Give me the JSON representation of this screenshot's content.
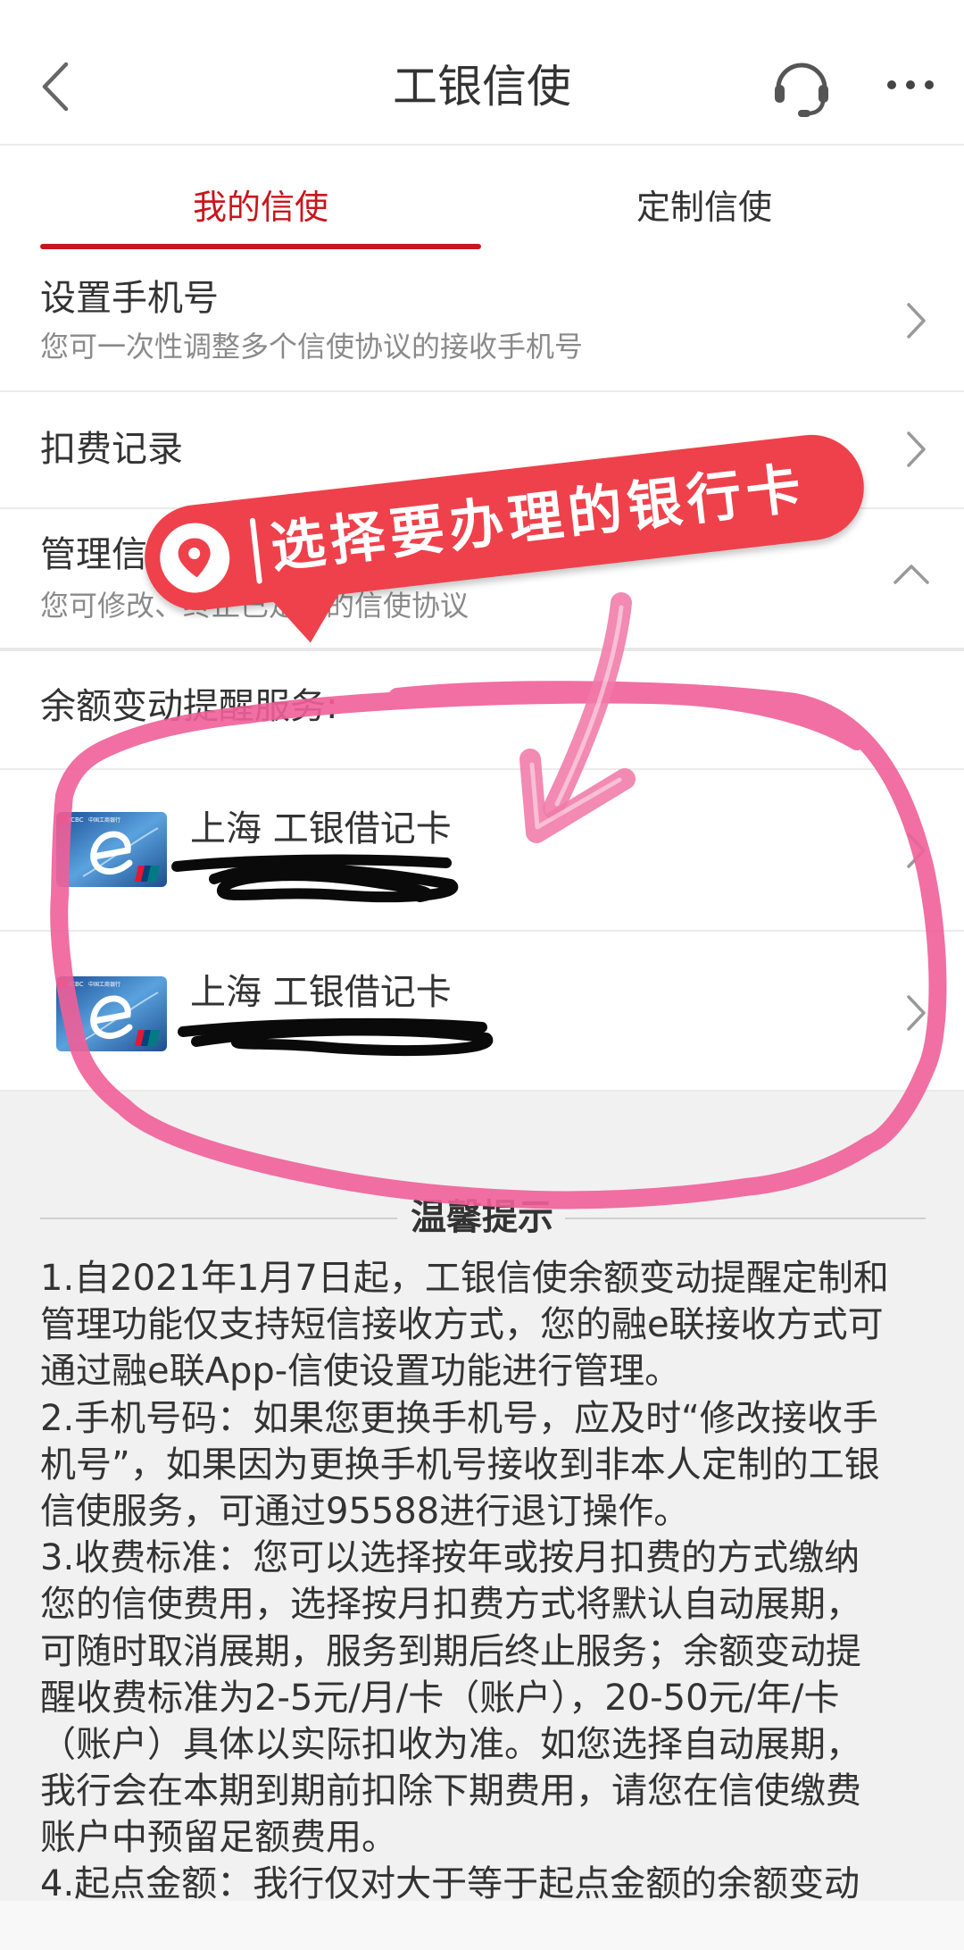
{
  "header": {
    "title": "工银信使",
    "back_icon": "chevron-left-icon",
    "service_icon": "headset-icon",
    "more_icon": "more-dots-icon"
  },
  "tabs": [
    {
      "label": "我的信使",
      "active": true
    },
    {
      "label": "定制信使",
      "active": false
    }
  ],
  "menu": [
    {
      "title": "设置手机号",
      "subtitle": "您可一次性调整多个信使协议的接收手机号",
      "icon": "chevron-right-icon"
    },
    {
      "title": "扣费记录",
      "icon": "chevron-right-icon"
    },
    {
      "title": "管理信使协议",
      "subtitle": "您可修改、终止已定制的信使协议",
      "icon": "chevron-up-icon",
      "expanded": true
    }
  ],
  "balance_service": {
    "label": "余额变动提醒服务:",
    "cards": [
      {
        "label": "上海 工银借记卡",
        "card_icon": "icbc-e-card-icon",
        "logo_text": "ICBC",
        "logo_bank_name": "中国工商银行",
        "icon": "chevron-right-icon"
      },
      {
        "label": "上海 工银借记卡",
        "card_icon": "icbc-e-card-icon",
        "logo_text": "ICBC",
        "logo_bank_name": "中国工商银行",
        "icon": "chevron-right-icon"
      }
    ]
  },
  "tips": {
    "title": "温馨提示",
    "lines": [
      "1.自2021年1月7日起，工银信使余额变动提醒定制和",
      "管理功能仅支持短信接收方式，您的融e联接收方式可",
      "通过融e联App-信使设置功能进行管理。",
      "2.手机号码：如果您更换手机号，应及时“修改接收手",
      "机号”，如果因为更换手机号接收到非本人定制的工银",
      "信使服务，可通过95588进行退订操作。",
      "3.收费标准：您可以选择按年或按月扣费的方式缴纳",
      "您的信使费用，选择按月扣费方式将默认自动展期，",
      "可随时取消展期，服务到期后终止服务；余额变动提",
      "醒收费标准为2-5元/月/卡（账户），20-50元/年/卡",
      "（账户）具体以实际扣收为准。如您选择自动展期，",
      "我行会在本期到期前扣除下期费用，请您在信使缴费",
      "账户中预留足额费用。",
      "4.起点金额：我行仅对大于等于起点金额的余额变动"
    ]
  },
  "annotation": {
    "callout_text": "选择要办理的银行卡",
    "callout_icon": "location-pin-icon",
    "arrow_icon": "hand-drawn-arrow-icon",
    "circle_icon": "hand-drawn-circle-icon"
  },
  "colors": {
    "accent": "#c8161d",
    "callout": "#ef414b",
    "highlight": "#ef5f98"
  }
}
